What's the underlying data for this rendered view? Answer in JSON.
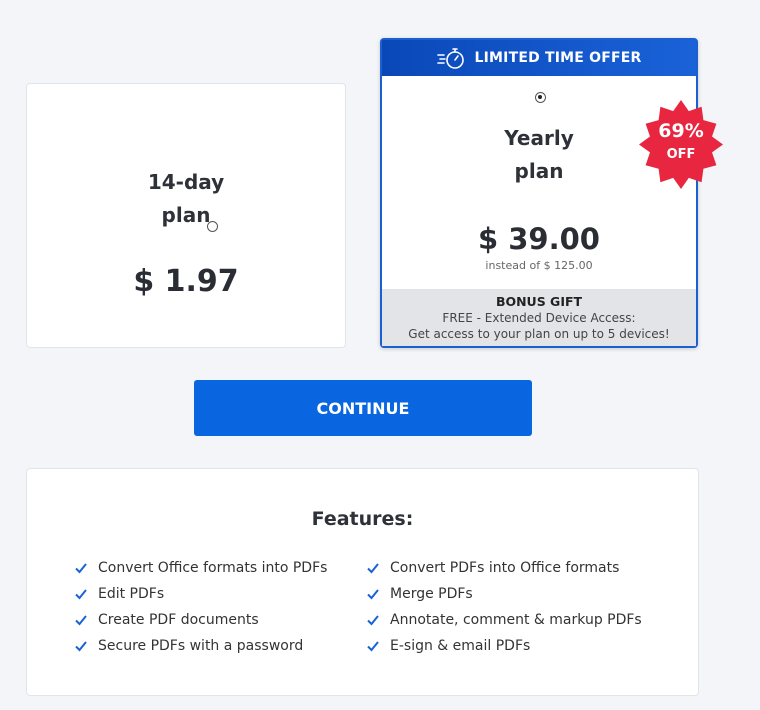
{
  "plans": [
    {
      "name_line1": "14-day",
      "name_line2": "plan",
      "price": "$ 1.97",
      "selected": false
    },
    {
      "name_line1": "Yearly",
      "name_line2": "plan",
      "price": "$ 39.00",
      "old_price": "instead of $ 125.00",
      "selected": true,
      "offer_label": "LIMITED TIME OFFER",
      "discount": {
        "percent": "69%",
        "label": "OFF"
      },
      "bonus": {
        "title": "BONUS GIFT",
        "line1": "FREE - Extended Device Access:",
        "line2": "Get access to your plan on up to 5 devices!"
      }
    }
  ],
  "continue_label": "CONTINUE",
  "features": {
    "title": "Features:",
    "left": [
      "Convert Office formats into PDFs",
      "Edit PDFs",
      "Create PDF documents",
      "Secure PDFs with a password"
    ],
    "right": [
      "Convert PDFs into Office formats",
      "Merge PDFs",
      "Annotate, comment & markup PDFs",
      "E-sign & email PDFs"
    ]
  },
  "icons": {
    "offer": "stopwatch-icon",
    "check": "checkmark-icon",
    "radio": "radio-icon"
  },
  "colors": {
    "accent": "#0a66e0",
    "badge": "#e8263f",
    "check": "#1a62d8"
  }
}
